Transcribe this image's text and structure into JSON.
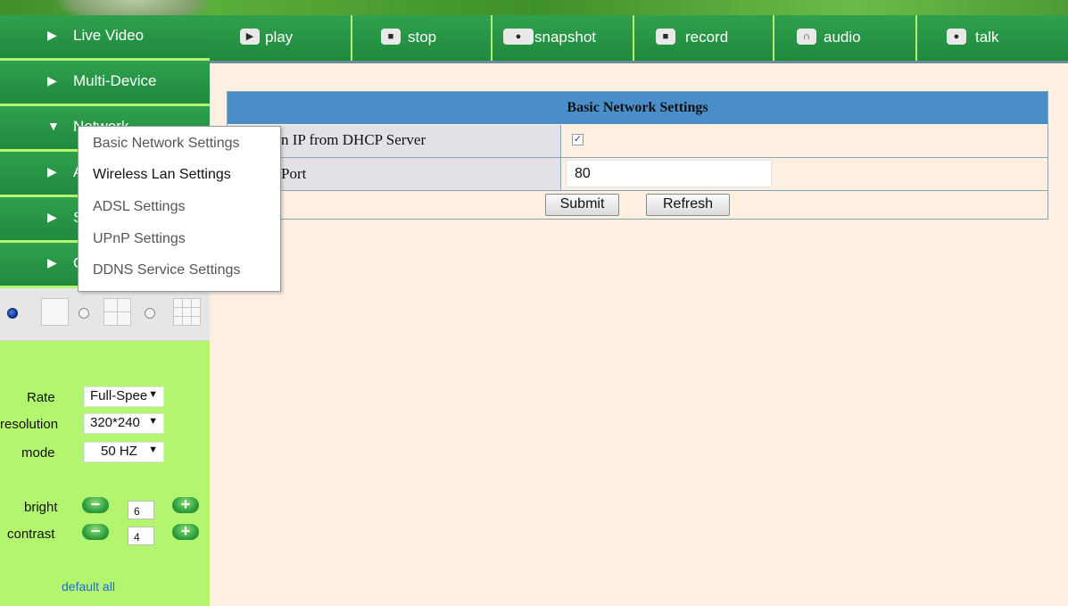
{
  "sidebar": {
    "items": [
      {
        "arrow": "▶",
        "label": "Live Video"
      },
      {
        "arrow": "▶",
        "label": "Multi-Device"
      },
      {
        "arrow": "▼",
        "label": "Network"
      },
      {
        "arrow": "▶",
        "label": "A"
      },
      {
        "arrow": "▶",
        "label": "S"
      },
      {
        "arrow": "▶",
        "label": "O"
      }
    ],
    "controls": {
      "rate_label": "Rate",
      "rate_value": "Full-Spee",
      "resolution_label": "resolution",
      "resolution_value": "320*240",
      "mode_label": "mode",
      "mode_value": "50 HZ",
      "bright_label": "bright",
      "bright_value": "6",
      "contrast_label": "contrast",
      "contrast_value": "4",
      "minus": "−",
      "plus": "+"
    },
    "default_all": "default all"
  },
  "toolbar": {
    "play": "play",
    "stop": "stop",
    "snapshot": "snapshot",
    "record": "record",
    "audio": "audio",
    "talk": "talk"
  },
  "network_menu": {
    "items": [
      "Basic Network Settings",
      "Wireless Lan Settings",
      "ADSL Settings",
      "UPnP Settings",
      "DDNS Service Settings"
    ]
  },
  "settings_table": {
    "title": "Basic Network Settings",
    "dhcp_label": "n IP from DHCP Server",
    "dhcp_checked": "✓",
    "port_label": "Port",
    "port_value": "80",
    "submit": "Submit",
    "refresh": "Refresh"
  },
  "colors": {
    "sidebar_bg": "#b4f56f",
    "nav_green": "#1f8a3d",
    "table_header": "#4a8ec9",
    "content_bg": "#fdf0e1"
  }
}
